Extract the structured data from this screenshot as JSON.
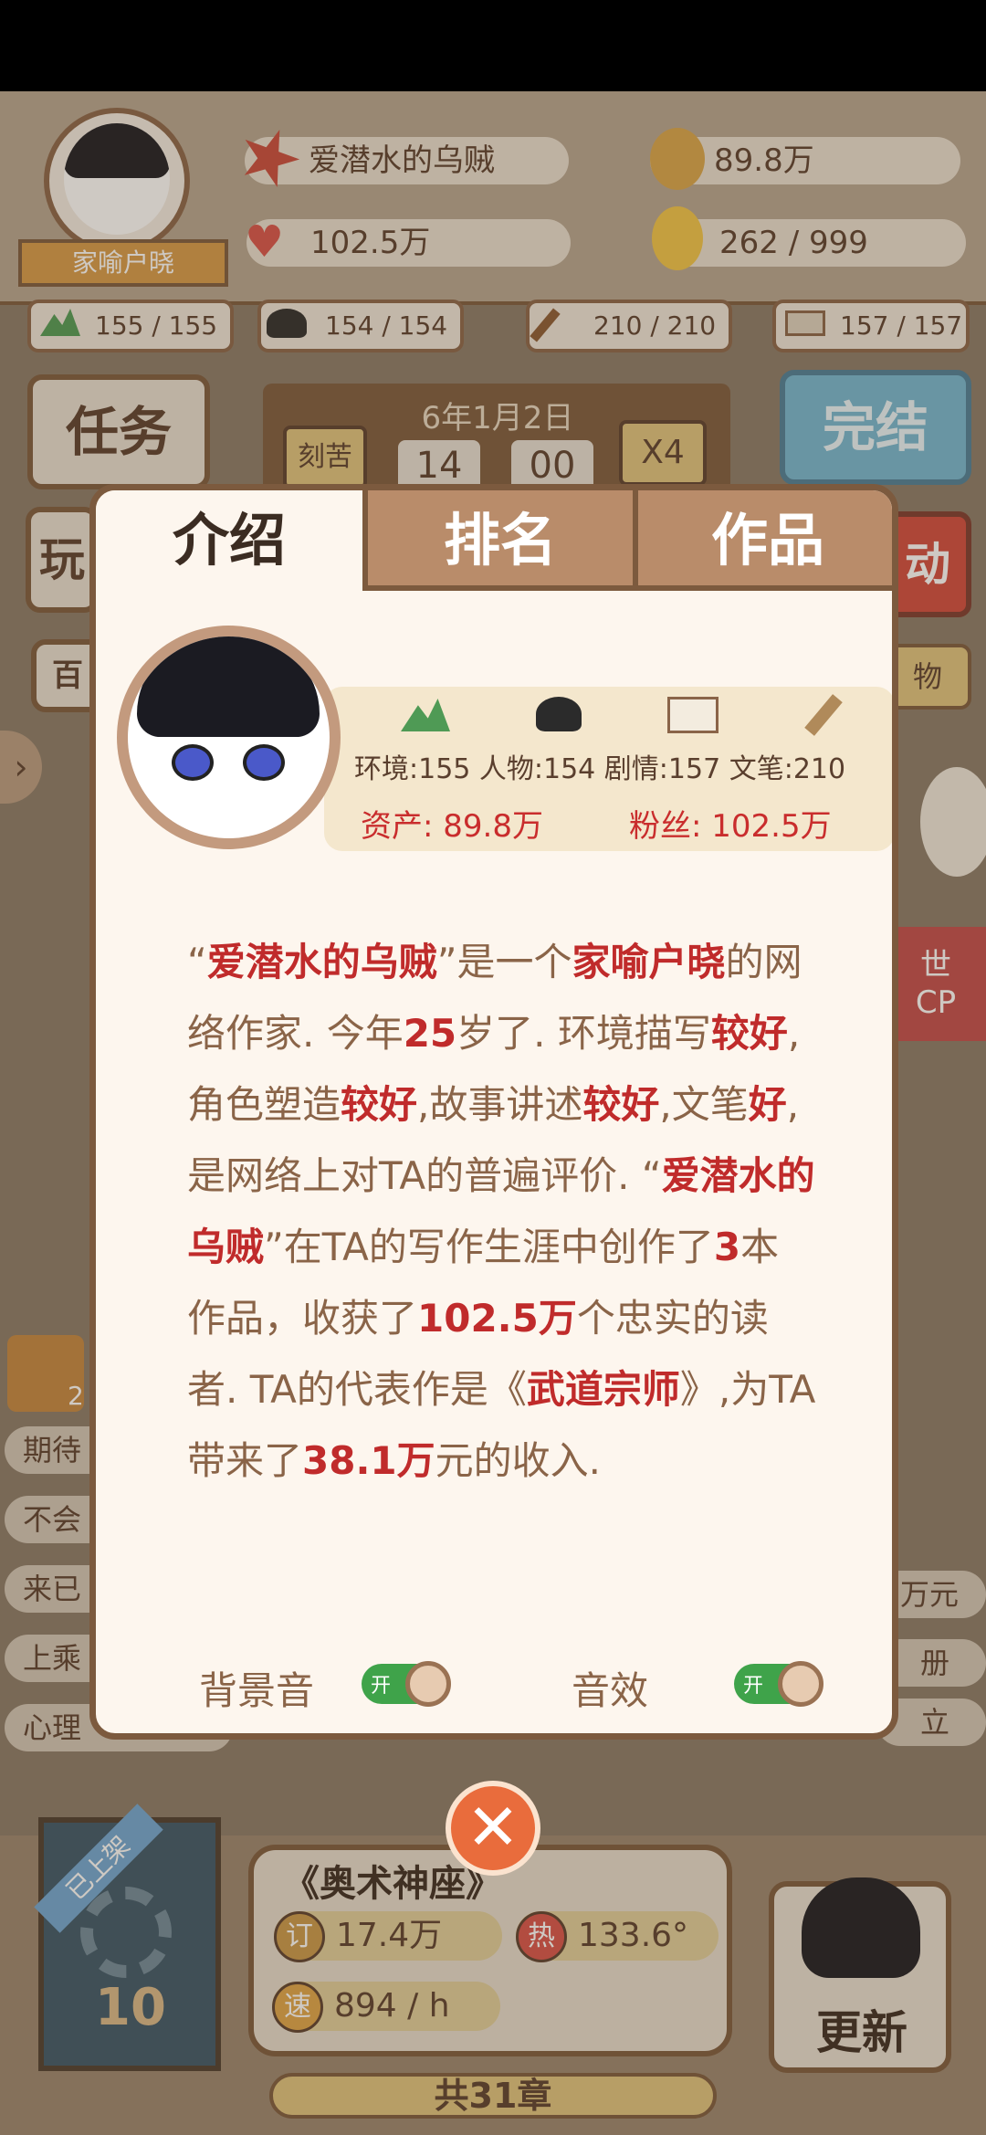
{
  "hud": {
    "player_name": "爱潜水的乌贼",
    "rank_title": "家喻户晓",
    "money": "89.8万",
    "fans": "102.5万",
    "ideas": "262 / 999",
    "stats": [
      "155 / 155",
      "154 / 154",
      "210 / 210",
      "157 / 157"
    ],
    "date": "6年1月2日",
    "time_hour": "14",
    "time_min": "00",
    "mode_label": "刻苦",
    "speed_label": "X4",
    "task_button": "任务",
    "finish_button": "完结",
    "play_button_partial": "玩",
    "right_partial": "动",
    "left_partial_2": "百",
    "right_partial_2": "物",
    "right_side_text_1": "世",
    "right_side_text_2": "CP"
  },
  "modal": {
    "tabs": [
      "介绍",
      "排名",
      "作品"
    ],
    "active_tab": 0,
    "stats_line": "环境:155 人物:154 剧情:157 文笔:210",
    "assets_line": "资产: 89.8万",
    "fans_line": "粉丝: 102.5万",
    "description": {
      "p1": "“",
      "name": "爱潜水的乌贼",
      "p2": "”是一个",
      "rank": "家喻户晓",
      "p3": "的网络作家. 今年",
      "age": "25",
      "p4": "岁了. 环境描写",
      "env": "较好",
      "p5": ",角色塑造",
      "char": "较好",
      "p6": ",故事讲述",
      "story": "较好",
      "p7": ",文笔",
      "writing": "好",
      "p8": ",是网络上对TA的普遍评价. “",
      "name2": "爱潜水的乌贼",
      "p9": "”在TA的写作生涯中创作了",
      "works": "3",
      "p10": "本作品，收获了",
      "readers": "102.5万",
      "p11": "个忠实的读者. TA的代表作是《",
      "masterpiece": "武道宗师",
      "p12": "》,为TA带来了",
      "income": "38.1万",
      "p13": "元的收入."
    },
    "bgm_label": "背景音",
    "sfx_label": "音效",
    "toggle_on": "开"
  },
  "left_list": [
    "期待",
    "不会",
    "来已",
    "上乘",
    "心理"
  ],
  "right_list": [
    "万元",
    "册",
    "立"
  ],
  "bottom": {
    "book_badge": "已上架",
    "book_number": "10",
    "book_title": "《奥术神座》",
    "subs": "17.4万",
    "heat": "133.6°",
    "speed": "894 / h",
    "subs_icon": "订",
    "heat_icon": "热",
    "speed_icon": "速",
    "chapters": "共31章",
    "update_button": "更新",
    "treasure_partial": "2"
  },
  "colors": {
    "accent_red": "#c02b2b",
    "brown": "#7c5a3e",
    "panel_bg": "#fdf6ee",
    "tab_inactive": "#b98c6a",
    "toggle_green": "#3fa34a"
  }
}
